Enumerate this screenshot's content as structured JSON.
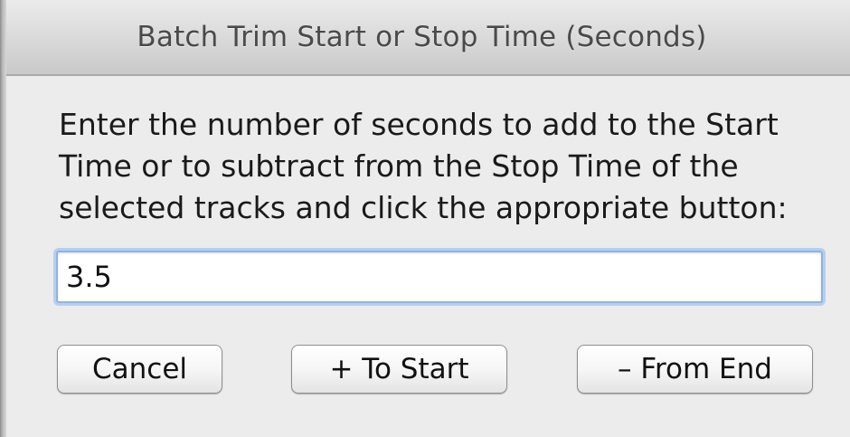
{
  "dialog": {
    "title": "Batch Trim Start or Stop Time (Seconds)",
    "message_lines": [
      "Enter the number of seconds to add to the Start",
      "Time or to subtract from the Stop Time of the",
      "selected tracks and click the appropriate button:"
    ],
    "seconds_value": "3.5",
    "buttons": {
      "cancel": "Cancel",
      "to_start": "+ To Start",
      "from_end": "– From End"
    }
  }
}
